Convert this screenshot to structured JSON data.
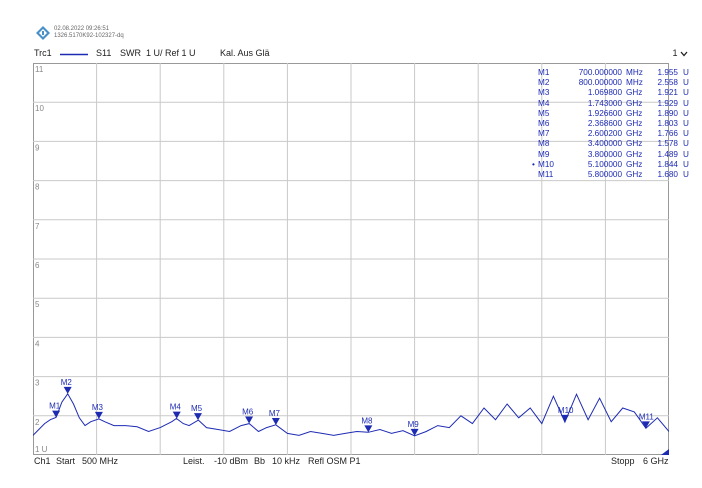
{
  "header": {
    "timestamp": "02.08.2022 09:26:51",
    "serial": "1326.5170K92-102327-dq"
  },
  "trace_bar": {
    "trace": "Trc1",
    "param": "S11",
    "format": "SWR",
    "scale": "1 U/ Ref 1 U",
    "cal": "Kal. Aus Glä",
    "right": "1"
  },
  "footer": {
    "channel": "Ch1",
    "start_label": "Start",
    "start_value": "500 MHz",
    "power_label": "Leist.",
    "power_value": "-10 dBm",
    "bw_label": "Bb",
    "bw_value": "10 kHz",
    "port": "Refl OSM P1",
    "stop_label": "Stopp",
    "stop_value": "6 GHz"
  },
  "markers": [
    {
      "name": "M1",
      "freq": "700.000000",
      "unit": "MHz",
      "value": "1.955",
      "vunit": "U",
      "active": false
    },
    {
      "name": "M2",
      "freq": "800.000000",
      "unit": "MHz",
      "value": "2.558",
      "vunit": "U",
      "active": false
    },
    {
      "name": "M3",
      "freq": "1.069800",
      "unit": "GHz",
      "value": "1.921",
      "vunit": "U",
      "active": false
    },
    {
      "name": "M4",
      "freq": "1.743000",
      "unit": "GHz",
      "value": "1.929",
      "vunit": "U",
      "active": false
    },
    {
      "name": "M5",
      "freq": "1.926600",
      "unit": "GHz",
      "value": "1.890",
      "vunit": "U",
      "active": false
    },
    {
      "name": "M6",
      "freq": "2.368600",
      "unit": "GHz",
      "value": "1.803",
      "vunit": "U",
      "active": false
    },
    {
      "name": "M7",
      "freq": "2.600200",
      "unit": "GHz",
      "value": "1.766",
      "vunit": "U",
      "active": false
    },
    {
      "name": "M8",
      "freq": "3.400000",
      "unit": "GHz",
      "value": "1.578",
      "vunit": "U",
      "active": false
    },
    {
      "name": "M9",
      "freq": "3.800000",
      "unit": "GHz",
      "value": "1.489",
      "vunit": "U",
      "active": false
    },
    {
      "name": "M10",
      "freq": "5.100000",
      "unit": "GHz",
      "value": "1.844",
      "vunit": "U",
      "active": true
    },
    {
      "name": "M11",
      "freq": "5.800000",
      "unit": "GHz",
      "value": "1.680",
      "vunit": "U",
      "active": false
    }
  ],
  "chart_data": {
    "type": "line",
    "xlim_ghz": [
      0.5,
      6.0
    ],
    "ylim": [
      1,
      11
    ],
    "y_ticks": [
      "11",
      "10",
      "9",
      "8",
      "7",
      "6",
      "5",
      "4",
      "3",
      "2",
      "1 U"
    ],
    "grid": true,
    "trace_color": "#1d2bb3",
    "series": [
      {
        "x_ghz": [
          0.5,
          0.55,
          0.6,
          0.65,
          0.7,
          0.75,
          0.8,
          0.85,
          0.9,
          0.95,
          1.0,
          1.07,
          1.12,
          1.2,
          1.3,
          1.4,
          1.5,
          1.6,
          1.7,
          1.74,
          1.8,
          1.85,
          1.93,
          2.0,
          2.1,
          2.2,
          2.3,
          2.37,
          2.45,
          2.52,
          2.6,
          2.7,
          2.8,
          2.9,
          3.0,
          3.1,
          3.2,
          3.3,
          3.4,
          3.5,
          3.6,
          3.7,
          3.8,
          3.9,
          4.0,
          4.1,
          4.2,
          4.3,
          4.4,
          4.5,
          4.6,
          4.7,
          4.8,
          4.9,
          5.0,
          5.1,
          5.2,
          5.3,
          5.4,
          5.5,
          5.6,
          5.7,
          5.8,
          5.9,
          6.0
        ],
        "values": [
          1.5,
          1.65,
          1.8,
          1.9,
          1.96,
          2.35,
          2.56,
          2.3,
          1.95,
          1.75,
          1.85,
          1.92,
          1.85,
          1.75,
          1.75,
          1.72,
          1.6,
          1.7,
          1.85,
          1.93,
          1.8,
          1.75,
          1.89,
          1.7,
          1.65,
          1.6,
          1.75,
          1.8,
          1.6,
          1.7,
          1.77,
          1.55,
          1.5,
          1.6,
          1.55,
          1.5,
          1.55,
          1.6,
          1.58,
          1.65,
          1.55,
          1.62,
          1.49,
          1.6,
          1.75,
          1.7,
          2.0,
          1.8,
          2.2,
          1.9,
          2.3,
          1.95,
          2.2,
          1.8,
          2.5,
          1.84,
          2.55,
          1.9,
          2.45,
          1.85,
          2.2,
          2.1,
          1.68,
          1.95,
          1.6
        ]
      }
    ]
  }
}
